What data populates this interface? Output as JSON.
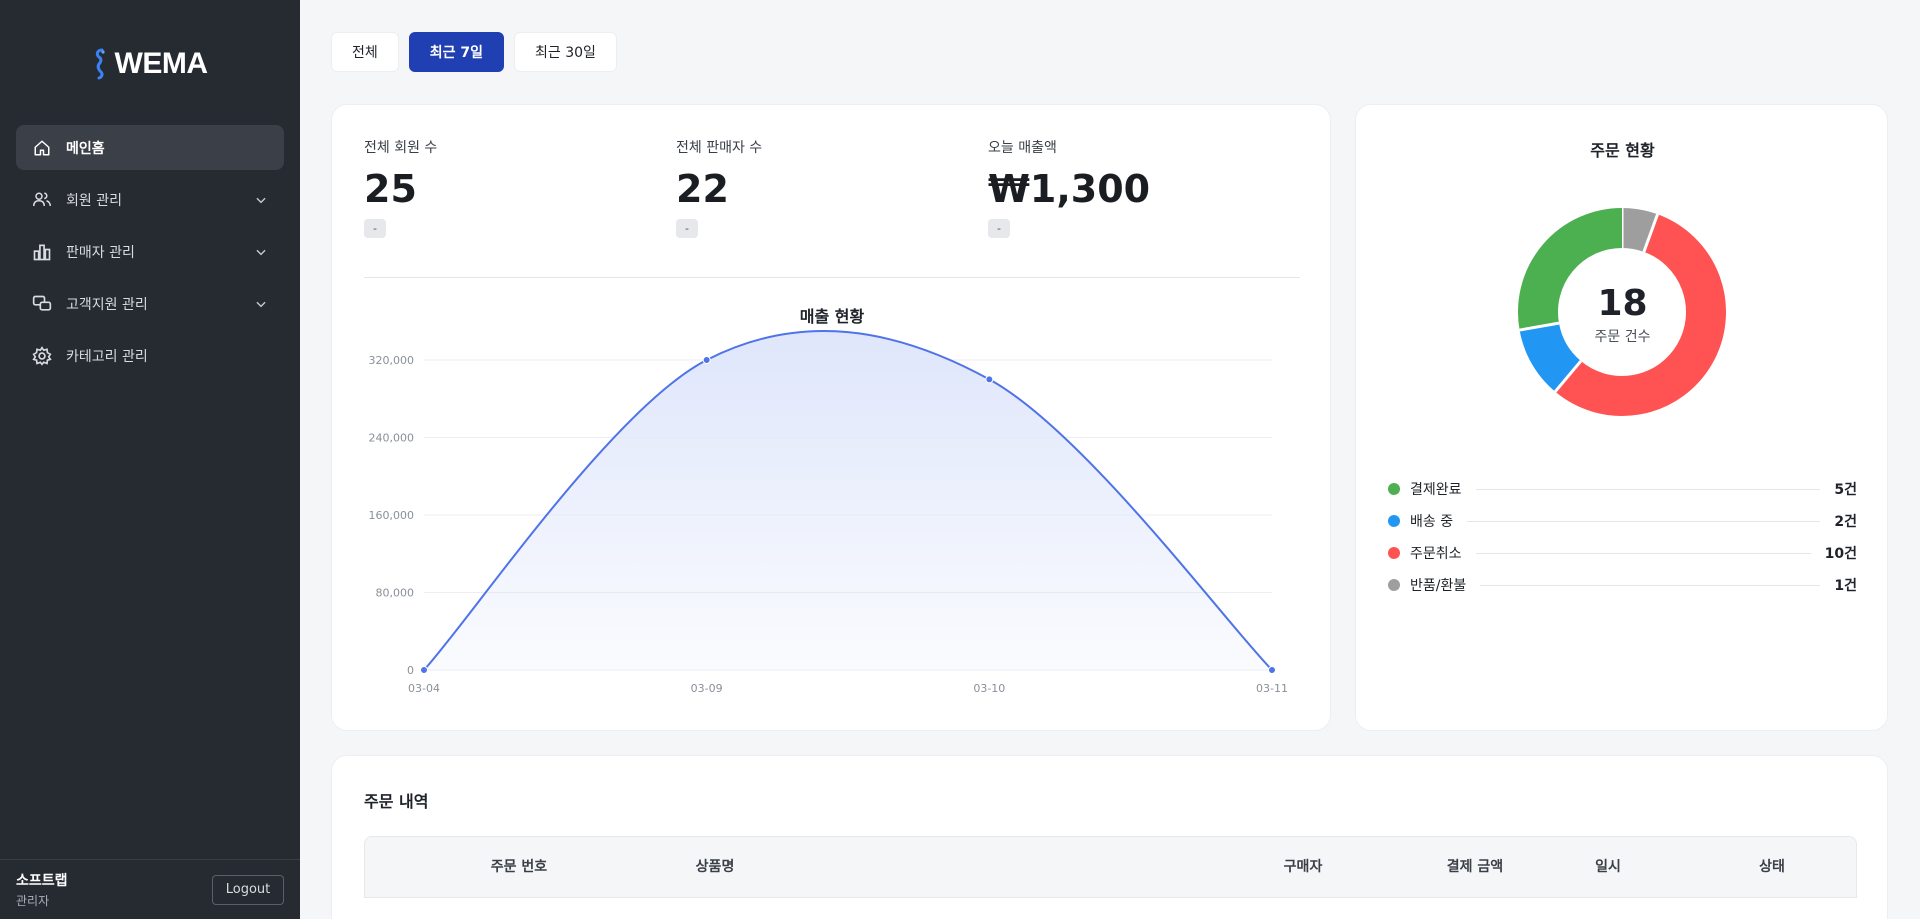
{
  "brand": {
    "name": "WEMA"
  },
  "sidebar": {
    "items": [
      {
        "label": "메인홈",
        "icon": "home-icon",
        "active": true,
        "expandable": false
      },
      {
        "label": "회원 관리",
        "icon": "users-icon",
        "active": false,
        "expandable": true
      },
      {
        "label": "판매자 관리",
        "icon": "bar-chart-icon",
        "active": false,
        "expandable": true
      },
      {
        "label": "고객지원 관리",
        "icon": "chat-icon",
        "active": false,
        "expandable": true
      },
      {
        "label": "카테고리 관리",
        "icon": "gear-icon",
        "active": false,
        "expandable": false
      }
    ],
    "user": {
      "name": "소프트랩",
      "role": "관리자"
    },
    "logout_label": "Logout"
  },
  "filters": {
    "tabs": [
      "전체",
      "최근 7일",
      "최근 30일"
    ],
    "active_index": 1
  },
  "stats": [
    {
      "label": "전체 회원 수",
      "value": "25",
      "badge": "-"
    },
    {
      "label": "전체 판매자 수",
      "value": "22",
      "badge": "-"
    },
    {
      "label": "오늘 매출액",
      "value": "₩1,300",
      "badge": "-"
    }
  ],
  "chart_data": {
    "type": "area",
    "title": "매출 현황",
    "categories": [
      "03-04",
      "03-09",
      "03-10",
      "03-11"
    ],
    "series": [
      {
        "values": [
          0,
          320000,
          300000,
          0
        ]
      }
    ],
    "ylim": [
      0,
      320000
    ],
    "yticks": [
      0,
      80000,
      160000,
      240000,
      320000
    ],
    "ytick_labels": [
      "0",
      "80,000",
      "160,000",
      "240,000",
      "320,000"
    ],
    "grid": true,
    "colors": {
      "line": "#4f73e8",
      "fill": "#dfe6fb"
    }
  },
  "order_status": {
    "title": "주문 현황",
    "total": "18",
    "total_label": "주문 건수",
    "items": [
      {
        "label": "결제완료",
        "count": 5,
        "count_label": "5건",
        "color": "#4caf50"
      },
      {
        "label": "배송 중",
        "count": 2,
        "count_label": "2건",
        "color": "#2196f3"
      },
      {
        "label": "주문취소",
        "count": 10,
        "count_label": "10건",
        "color": "#ff5252"
      },
      {
        "label": "반품/환불",
        "count": 1,
        "count_label": "1건",
        "color": "#9e9e9e"
      }
    ]
  },
  "orders": {
    "title": "주문 내역",
    "columns": [
      "주문 번호",
      "상품명",
      "구매자",
      "결제 금액",
      "일시",
      "상태"
    ]
  },
  "colors": {
    "sidebar_bg": "#262a31",
    "accent": "#1f3fb3"
  }
}
